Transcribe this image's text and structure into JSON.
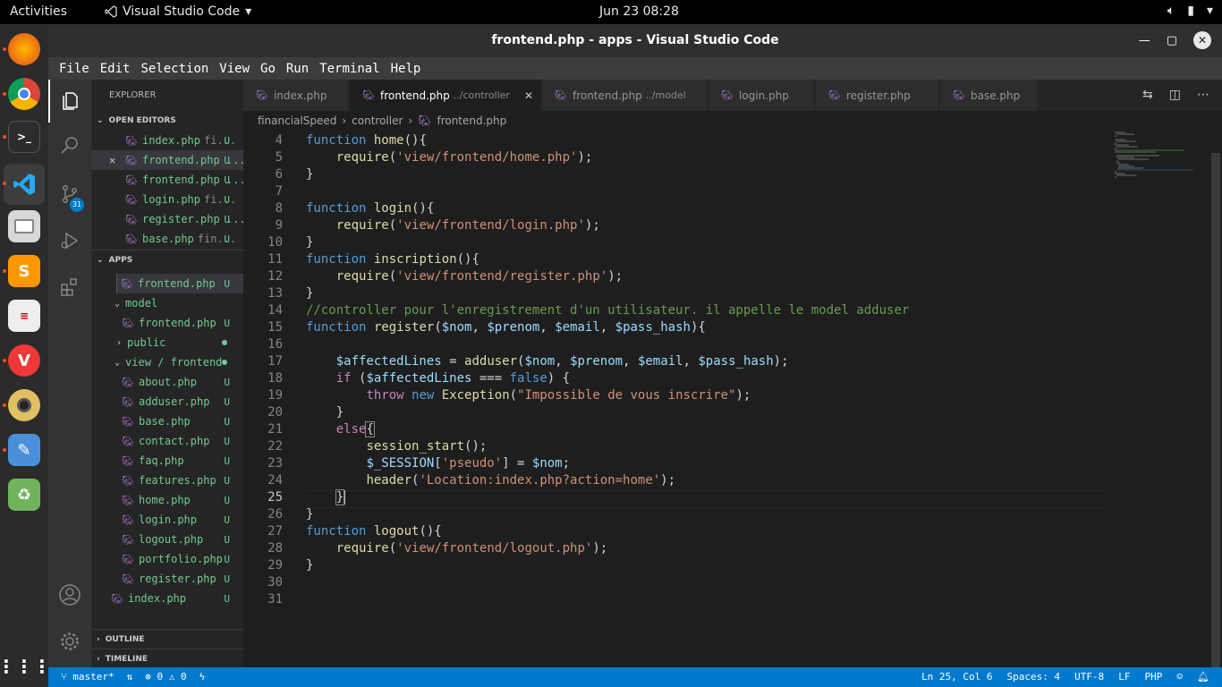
{
  "topbar": {
    "activities": "Activities",
    "app_name": "Visual Studio Code",
    "clock": "Jun 23  08:28"
  },
  "dock": {
    "items": [
      "firefox-icon",
      "chrome-icon",
      "terminal-icon",
      "vscode-icon",
      "files-icon",
      "sublime-icon",
      "notes-icon",
      "vivaldi-icon",
      "rhythmbox-icon",
      "text-editor-icon",
      "trash-icon",
      "apps-grid-icon"
    ]
  },
  "window": {
    "title": "frontend.php - apps - Visual Studio Code"
  },
  "menu": [
    "File",
    "Edit",
    "Selection",
    "View",
    "Go",
    "Run",
    "Terminal",
    "Help"
  ],
  "activity": {
    "scm_badge": "31"
  },
  "sidebar": {
    "header": "EXPLORER",
    "open_editors_label": "OPEN EDITORS",
    "open_editors": [
      {
        "name": "index.php",
        "dim": "fi...",
        "status": "U"
      },
      {
        "name": "frontend.php ...",
        "dim": "",
        "status": "U"
      },
      {
        "name": "frontend.php ...",
        "dim": "",
        "status": "U"
      },
      {
        "name": "login.php",
        "dim": "fi...",
        "status": "U"
      },
      {
        "name": "register.php ...",
        "dim": "",
        "status": "U"
      },
      {
        "name": "base.php",
        "dim": "fin...",
        "status": "U"
      }
    ],
    "apps_label": "APPS",
    "tree": {
      "frontend": "frontend.php",
      "model_folder": "model",
      "model_frontend": "frontend.php",
      "public_folder": "public",
      "view_folder": "view / frontend",
      "view_files": [
        "about.php",
        "adduser.php",
        "base.php",
        "contact.php",
        "faq.php",
        "features.php",
        "home.php",
        "login.php",
        "logout.php",
        "portfolio.php",
        "register.php"
      ],
      "index": "index.php",
      "status_u": "U"
    },
    "outline_label": "OUTLINE",
    "timeline_label": "TIMELINE"
  },
  "tabs": [
    {
      "label": "index.php",
      "dim": ""
    },
    {
      "label": "frontend.php",
      "dim": "../controller"
    },
    {
      "label": "frontend.php",
      "dim": "../model"
    },
    {
      "label": "login.php",
      "dim": ""
    },
    {
      "label": "register.php",
      "dim": ""
    },
    {
      "label": "base.php",
      "dim": ""
    }
  ],
  "breadcrumb": [
    "financialSpeed",
    "controller",
    "frontend.php"
  ],
  "editor": {
    "line_numbers": [
      "4",
      "5",
      "6",
      "7",
      "8",
      "9",
      "10",
      "11",
      "12",
      "13",
      "14",
      "15",
      "16",
      "17",
      "18",
      "19",
      "20",
      "21",
      "22",
      "23",
      "24",
      "25",
      "26",
      "27",
      "28",
      "29",
      "30",
      "31"
    ]
  },
  "statusbar": {
    "branch": "master*",
    "errors": "0",
    "warnings": "0",
    "position": "Ln 25, Col 6",
    "spaces": "Spaces: 4",
    "encoding": "UTF-8",
    "eol": "LF",
    "language": "PHP"
  }
}
